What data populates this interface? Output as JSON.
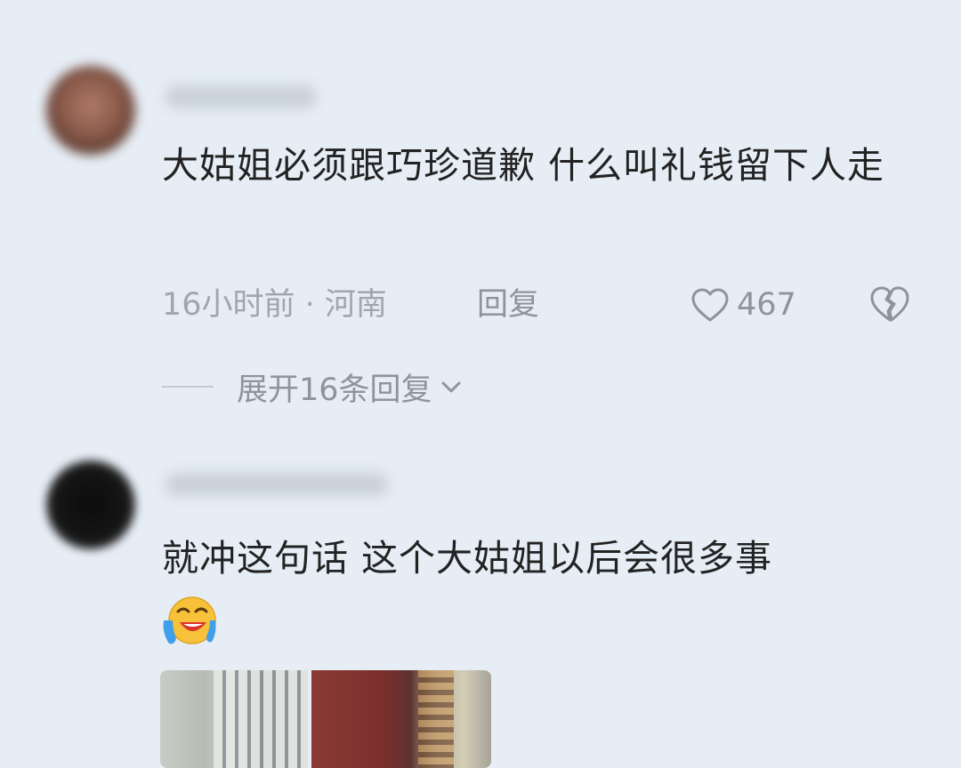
{
  "comments": [
    {
      "text": "大姑姐必须跟巧珍道歉  什么叫礼钱留下人走",
      "time_location": "16小时前 · 河南",
      "reply_label": "回复",
      "like_count": "467",
      "expand_label": "展开16条回复"
    },
    {
      "text": "就冲这句话 这个大姑姐以后会很多事",
      "emoji": "crying-laughing"
    }
  ],
  "icons": {
    "like": "heart-outline-icon",
    "dislike": "broken-heart-icon",
    "expand": "chevron-down-icon"
  },
  "colors": {
    "background": "#e6edf5",
    "text": "#222222",
    "meta": "#a0a6ad"
  }
}
